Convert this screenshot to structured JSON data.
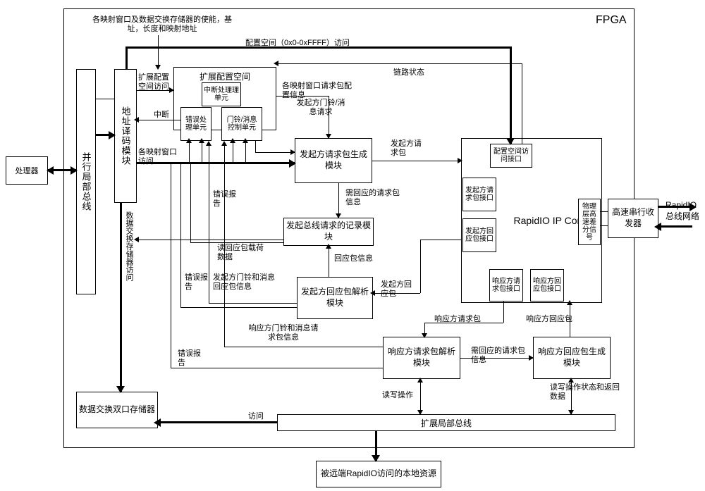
{
  "fpga": "FPGA",
  "processor": "处理器",
  "parallel_local_bus": "并行局部总线",
  "address_decode": "地址译码模块",
  "ext_config_space": "扩展配置空间",
  "interrupt_handler": "中断处理理单元",
  "error_handler": "错误处理单元",
  "doorbell_msg_ctrl": "门铃/消息控制单元",
  "initiator_req_gen": "发起方请求包生成模块",
  "initiator_record": "发起总线请求的记录模块",
  "initiator_resp_parse": "发起方回应包解析模块",
  "responder_req_parse": "响应方请求包解析模块",
  "responder_resp_gen": "响应方回应包生成模块",
  "rapidio_ip": "RapidIO IP Core",
  "config_space_iface": "配置空间访问接口",
  "initiator_req_iface": "发起方请求包接口",
  "initiator_resp_iface": "发起方回应包接口",
  "responder_req_iface": "响应方请求包接口",
  "responder_resp_iface": "响应方回应包接口",
  "phy_diff_signal": "物理层高速差分信号",
  "hs_serial_trx": "高速串行收发器",
  "rapidio_bus_net": "RapidIO总线网络",
  "data_exchange_dualport": "数据交换双口存储器",
  "ext_local_bus": "扩展局部总线",
  "remote_local_res": "被远端RapidIO访问的本地资源",
  "lbl_mapping_window_etc": "各映射窗口及数据交换存储器的使能，基址，长度和映射地址",
  "lbl_config_space_access": "配置空间（0x0-0xFFFF）访问",
  "lbl_link_status": "链路状态",
  "lbl_ext_config_access": "扩展配置空间访问",
  "lbl_interrupt": "中断",
  "lbl_mapping_window_access": "各映射窗口访问",
  "lbl_data_exchange_mem_access": "数据交换存储器访问",
  "lbl_mapping_window_req_config": "各映射窗口请求包配置信息",
  "lbl_initiator_doorbell_msg_req": "发起方门铃/消息请求",
  "lbl_initiator_req_pkt": "发起方请求包",
  "lbl_need_resp_req_info": "需回应的请求包信息",
  "lbl_error_report": "错误报告",
  "lbl_resp_pkt_info": "回应包信息",
  "lbl_read_resp_payload": "读回应包载荷数据",
  "lbl_initiator_doorbell_msg_resp": "发起方门铃和消息回应包信息",
  "lbl_initiator_resp_pkt": "发起方回应包",
  "lbl_responder_req_pkt": "响应方请求包",
  "lbl_responder_resp_pkt": "响应方回应包",
  "lbl_responder_doorbell_msg_req_info": "响应方门铃和消息请求包信息",
  "lbl_need_resp_req_info2": "需回应的请求包信息",
  "lbl_rw_op": "读写操作",
  "lbl_rw_op_status": "读写操作状态和返回数据",
  "lbl_access": "访问"
}
